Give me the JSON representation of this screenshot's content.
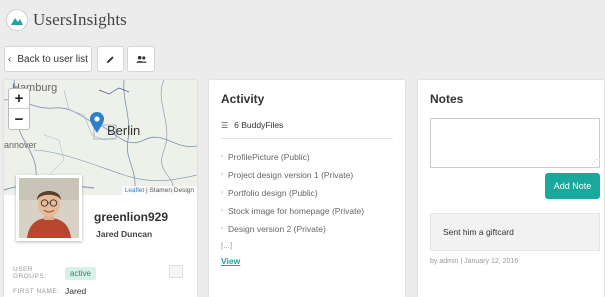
{
  "brand": {
    "name": "UsersInsights"
  },
  "toolbar": {
    "back_label": "Back to user list",
    "back_icon": "chevron-left-icon",
    "edit_icon": "pencil-icon",
    "groups_icon": "users-icon"
  },
  "profile": {
    "map": {
      "labels": [
        "Hamburg",
        "annover",
        "Berlin"
      ],
      "zoom_in": "+",
      "zoom_out": "−",
      "attribution": {
        "leaflet": "Leaflet",
        "separator": " | ",
        "stamen": "Stamen Design"
      }
    },
    "username": "greenlion929",
    "full_name": "Jared Duncan",
    "fields": [
      {
        "key": "USER GROUPS:",
        "value": "active"
      },
      {
        "key": "FIRST NAME:",
        "value": "Jared"
      }
    ]
  },
  "activity": {
    "title": "Activity",
    "section_label": "6 BuddyFiles",
    "items": [
      "ProfilePicture (Public)",
      "Project design version 1 (Private)",
      "Portfolio design (Public)",
      "Stock image for homepage (Private)",
      "Design version 2 (Private)"
    ],
    "ellipsis": "[...]",
    "view_label": "View"
  },
  "notes": {
    "title": "Notes",
    "textarea_value": "",
    "add_label": "Add Note",
    "entries": [
      {
        "text": "Sent him a giftcard",
        "meta": "by admin | January 12, 2016"
      }
    ]
  },
  "colors": {
    "accent": "#1aa89c",
    "link": "#1fa39a",
    "marker": "#2e7fc9"
  }
}
